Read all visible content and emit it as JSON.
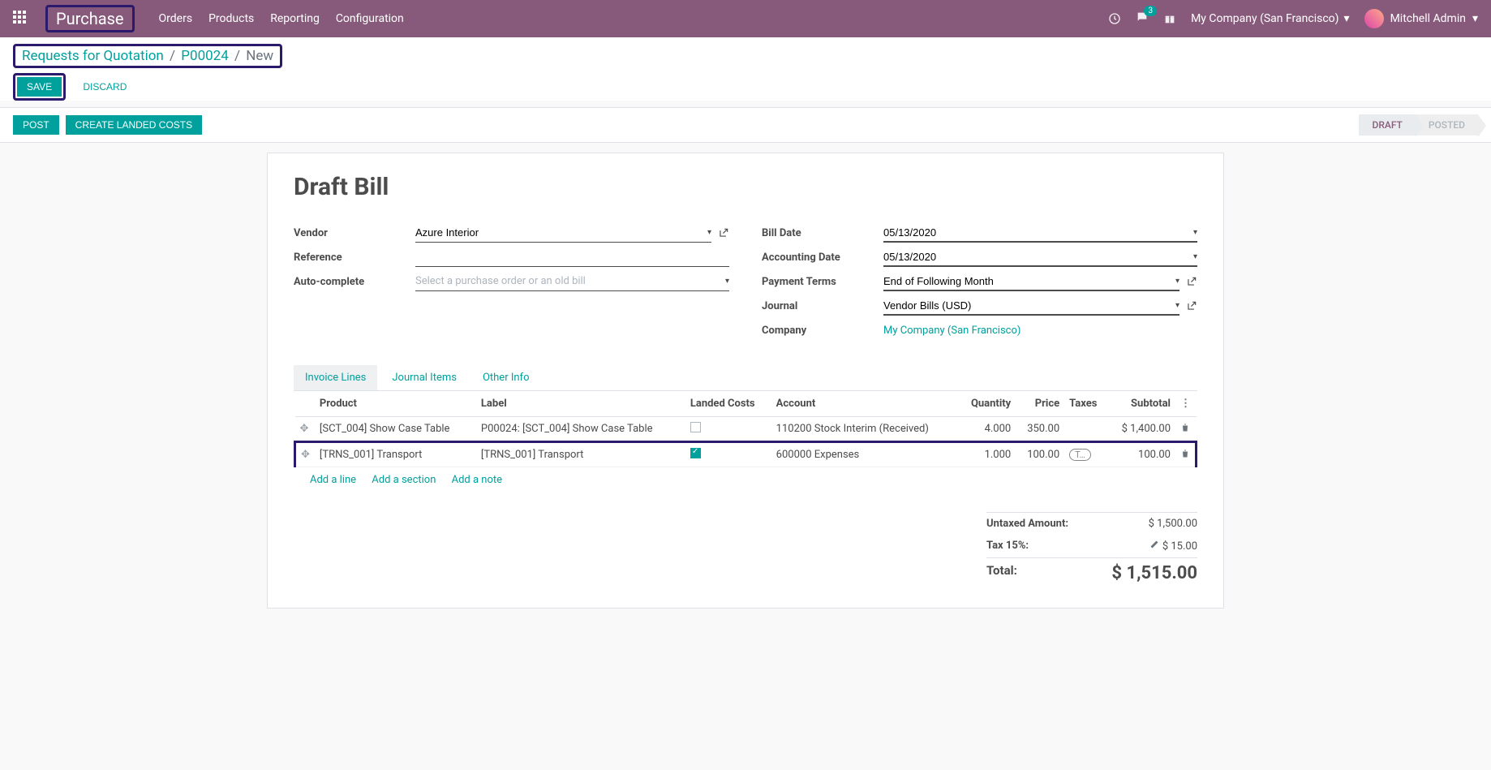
{
  "navbar": {
    "brand": "Purchase",
    "links": [
      "Orders",
      "Products",
      "Reporting",
      "Configuration"
    ],
    "messages_count": "3",
    "company": "My Company (San Francisco)",
    "user": "Mitchell Admin"
  },
  "breadcrumb": {
    "root": "Requests for Quotation",
    "middle": "P00024",
    "current": "New"
  },
  "buttons": {
    "save": "SAVE",
    "discard": "DISCARD",
    "post": "POST",
    "create_landed": "CREATE LANDED COSTS"
  },
  "status": {
    "draft": "DRAFT",
    "posted": "POSTED"
  },
  "form": {
    "title": "Draft Bill",
    "labels": {
      "vendor": "Vendor",
      "reference": "Reference",
      "auto_complete": "Auto-complete",
      "bill_date": "Bill Date",
      "accounting_date": "Accounting Date",
      "payment_terms": "Payment Terms",
      "journal": "Journal",
      "company": "Company"
    },
    "values": {
      "vendor": "Azure Interior",
      "reference": "",
      "auto_complete_placeholder": "Select a purchase order or an old bill",
      "bill_date": "05/13/2020",
      "accounting_date": "05/13/2020",
      "payment_terms": "End of Following Month",
      "journal": "Vendor Bills (USD)",
      "company": "My Company (San Francisco)"
    }
  },
  "tabs": [
    "Invoice Lines",
    "Journal Items",
    "Other Info"
  ],
  "table": {
    "headers": {
      "product": "Product",
      "label": "Label",
      "landed": "Landed Costs",
      "account": "Account",
      "quantity": "Quantity",
      "price": "Price",
      "taxes": "Taxes",
      "subtotal": "Subtotal"
    },
    "rows": [
      {
        "product": "[SCT_004] Show Case Table",
        "label": "P00024: [SCT_004] Show Case Table",
        "landed": false,
        "account": "110200 Stock Interim (Received)",
        "quantity": "4.000",
        "price": "350.00",
        "taxes": "",
        "subtotal": "$ 1,400.00"
      },
      {
        "product": "[TRNS_001] Transport",
        "label": "[TRNS_001] Transport",
        "landed": true,
        "account": "600000 Expenses",
        "quantity": "1.000",
        "price": "100.00",
        "taxes": "T…",
        "subtotal": "100.00"
      }
    ],
    "add_links": {
      "add_line": "Add a line",
      "add_section": "Add a section",
      "add_note": "Add a note"
    }
  },
  "totals": {
    "untaxed_label": "Untaxed Amount:",
    "untaxed_value": "$ 1,500.00",
    "tax_label": "Tax 15%:",
    "tax_value": "$ 15.00",
    "total_label": "Total:",
    "total_value": "$ 1,515.00"
  }
}
